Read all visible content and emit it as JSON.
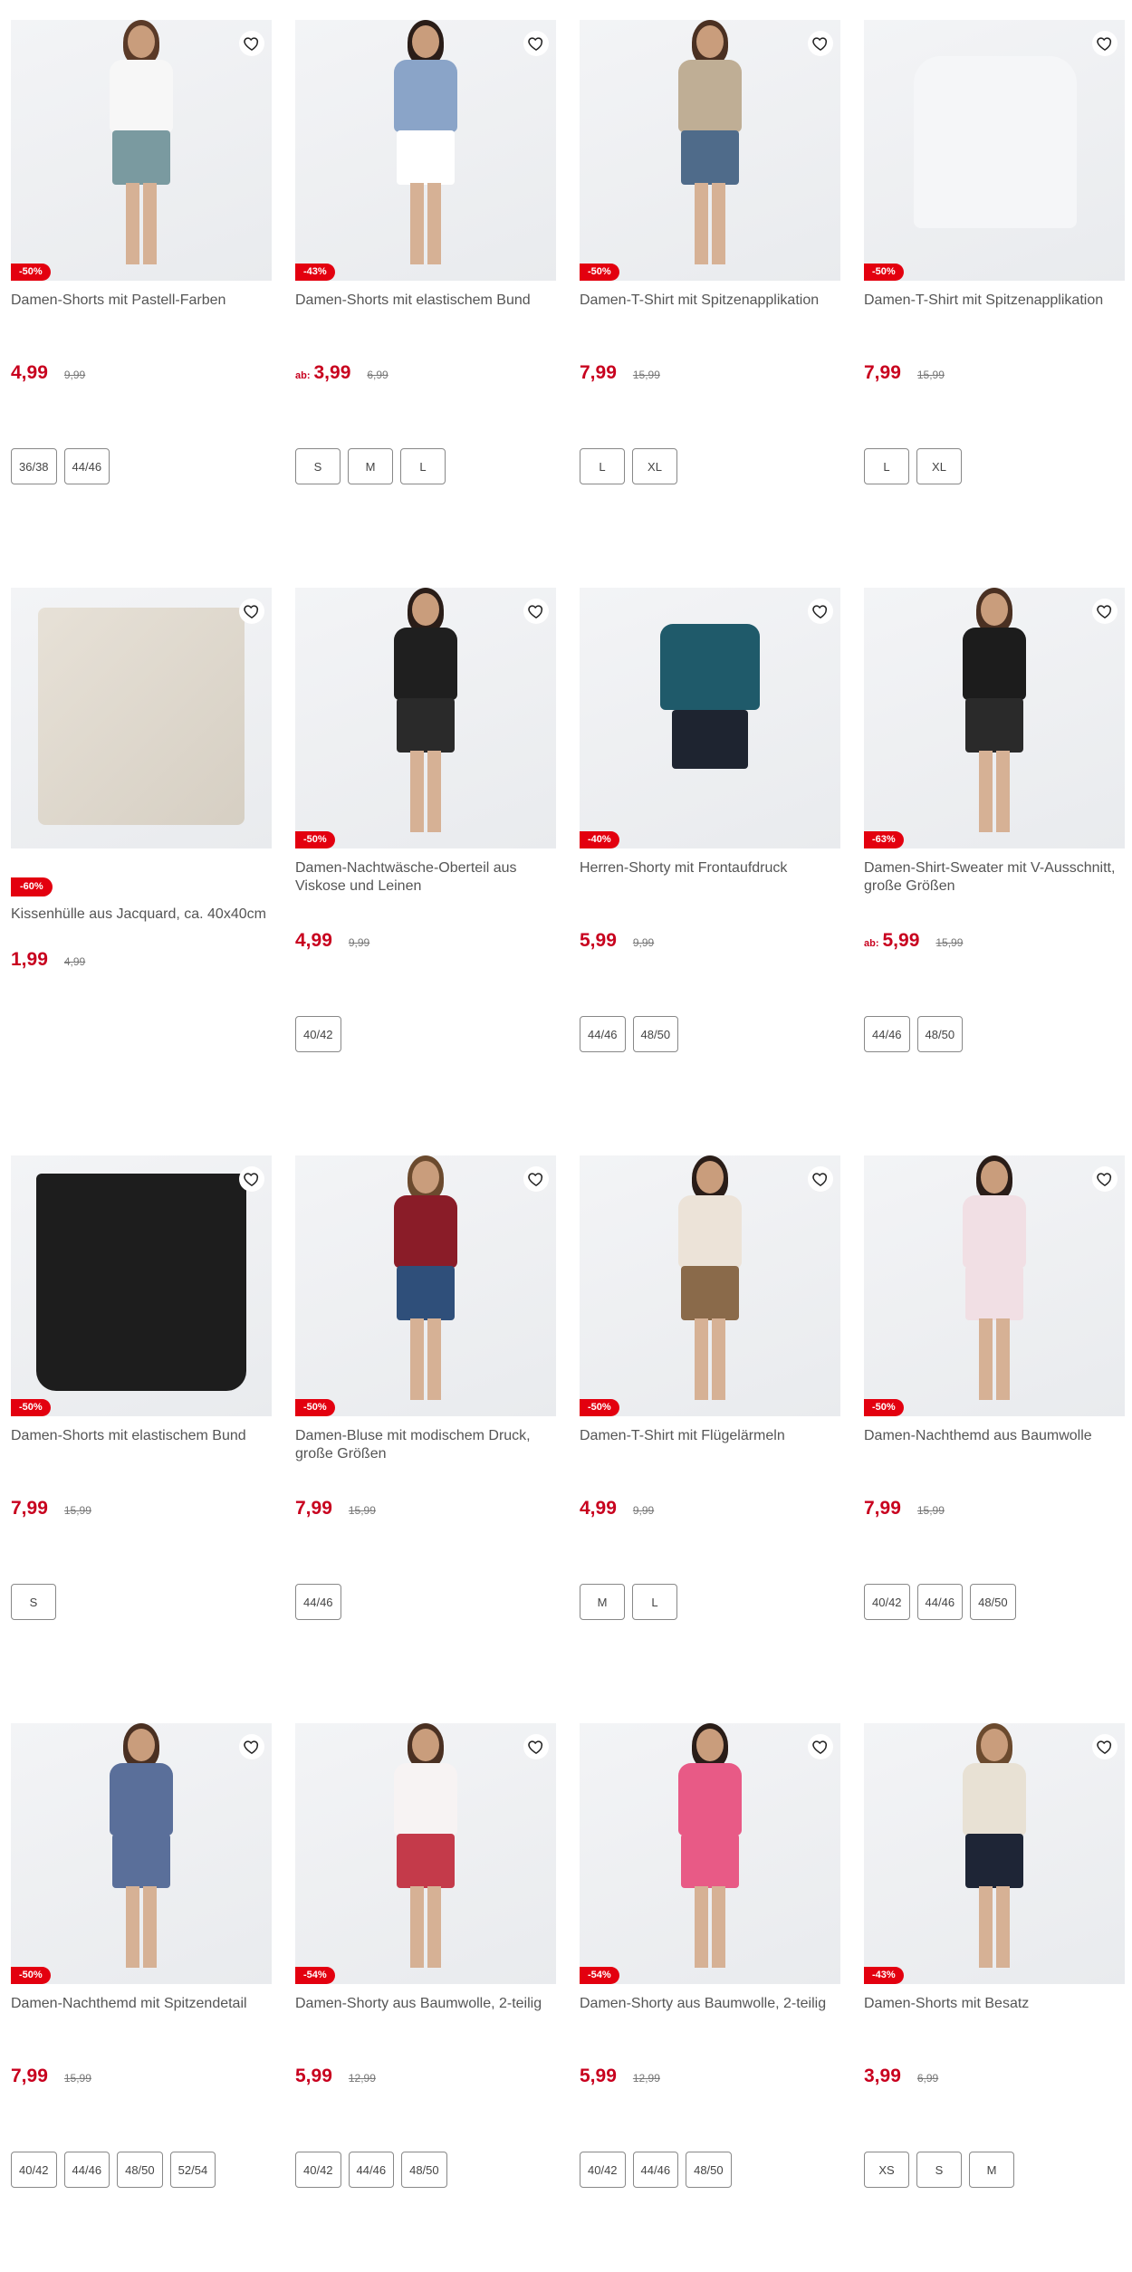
{
  "colors": {
    "accent": "#e3000f",
    "price": "#c8001e"
  },
  "products": [
    {
      "title": "Damen-Shorts mit Pastell-Farben",
      "badge": "-50%",
      "ab": "",
      "price": "4,99",
      "old": "9,99",
      "sizes": [
        "36/38",
        "44/46"
      ]
    },
    {
      "title": "Damen-Shorts mit elastischem Bund",
      "badge": "-43%",
      "ab": "ab:",
      "price": "3,99",
      "old": "6,99",
      "sizes": [
        "S",
        "M",
        "L"
      ]
    },
    {
      "title": "Damen-T-Shirt mit Spitzenapplikation",
      "badge": "-50%",
      "ab": "",
      "price": "7,99",
      "old": "15,99",
      "sizes": [
        "L",
        "XL"
      ]
    },
    {
      "title": "Damen-T-Shirt mit Spitzenapplikation",
      "badge": "-50%",
      "ab": "",
      "price": "7,99",
      "old": "15,99",
      "sizes": [
        "L",
        "XL"
      ]
    },
    {
      "title": "Kissenhülle aus Jacquard, ca. 40x40cm",
      "badge": "-60%",
      "ab": "",
      "price": "1,99",
      "old": "4,99",
      "sizes": []
    },
    {
      "title": "Damen-Nachtwäsche-Oberteil aus Viskose und Leinen",
      "badge": "-50%",
      "ab": "",
      "price": "4,99",
      "old": "9,99",
      "sizes": [
        "40/42"
      ]
    },
    {
      "title": "Herren-Shorty mit Frontaufdruck",
      "badge": "-40%",
      "ab": "",
      "price": "5,99",
      "old": "9,99",
      "sizes": [
        "44/46",
        "48/50"
      ]
    },
    {
      "title": "Damen-Shirt-Sweater mit V-Ausschnitt, große Größen",
      "badge": "-63%",
      "ab": "ab:",
      "price": "5,99",
      "old": "15,99",
      "sizes": [
        "44/46",
        "48/50"
      ]
    },
    {
      "title": "Damen-Shorts mit elastischem Bund",
      "badge": "-50%",
      "ab": "",
      "price": "7,99",
      "old": "15,99",
      "sizes": [
        "S"
      ]
    },
    {
      "title": "Damen-Bluse mit modischem Druck, große Größen",
      "badge": "-50%",
      "ab": "",
      "price": "7,99",
      "old": "15,99",
      "sizes": [
        "44/46"
      ]
    },
    {
      "title": "Damen-T-Shirt mit Flügelärmeln",
      "badge": "-50%",
      "ab": "",
      "price": "4,99",
      "old": "9,99",
      "sizes": [
        "M",
        "L"
      ]
    },
    {
      "title": "Damen-Nachthemd aus Baumwolle",
      "badge": "-50%",
      "ab": "",
      "price": "7,99",
      "old": "15,99",
      "sizes": [
        "40/42",
        "44/46",
        "48/50"
      ]
    },
    {
      "title": "Damen-Nachthemd mit Spitzendetail",
      "badge": "-50%",
      "ab": "",
      "price": "7,99",
      "old": "15,99",
      "sizes": [
        "40/42",
        "44/46",
        "48/50",
        "52/54"
      ]
    },
    {
      "title": "Damen-Shorty aus Baumwolle, 2-teilig",
      "badge": "-54%",
      "ab": "",
      "price": "5,99",
      "old": "12,99",
      "sizes": [
        "40/42",
        "44/46",
        "48/50"
      ]
    },
    {
      "title": "Damen-Shorty aus Baumwolle, 2-teilig",
      "badge": "-54%",
      "ab": "",
      "price": "5,99",
      "old": "12,99",
      "sizes": [
        "40/42",
        "44/46",
        "48/50"
      ]
    },
    {
      "title": "Damen-Shorts mit Besatz",
      "badge": "-43%",
      "ab": "",
      "price": "3,99",
      "old": "6,99",
      "sizes": [
        "XS",
        "S",
        "M"
      ]
    }
  ]
}
